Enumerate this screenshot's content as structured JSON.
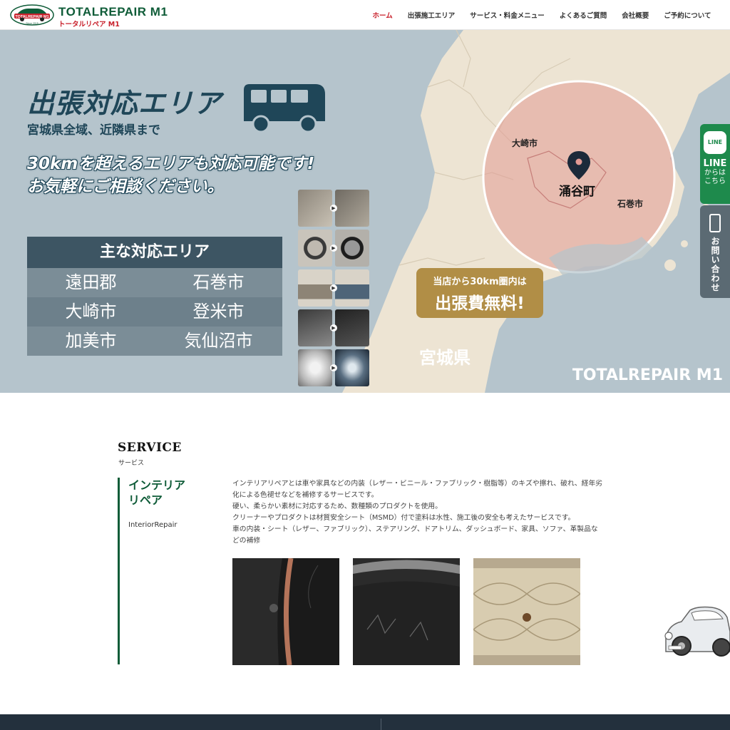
{
  "header": {
    "logo_badge_text": "TOTALREPAIR M1",
    "logo_since": "Since 2015",
    "logo_title": "TOTALREPAIR M1",
    "logo_sub": "トータルリペア M1",
    "nav": [
      {
        "label": "ホーム",
        "active": true
      },
      {
        "label": "出張施工エリア",
        "active": false
      },
      {
        "label": "サービス・料金メニュー",
        "active": false
      },
      {
        "label": "よくあるご質問",
        "active": false
      },
      {
        "label": "会社概要",
        "active": false
      },
      {
        "label": "ご予約について",
        "active": false
      }
    ]
  },
  "hero": {
    "title": "出張対応エリア",
    "subtitle": "宮城県全域、近隣県まで",
    "message_line1": "30kmを超えるエリアも対応可能です!",
    "message_line2": "お気軽にご相談ください。",
    "areas_heading": "主な対応エリア",
    "areas": [
      [
        "遠田郡",
        "石巻市"
      ],
      [
        "大崎市",
        "登米市"
      ],
      [
        "加美市",
        "気仙沼市"
      ]
    ],
    "free_small": "当店から30km圏内は",
    "free_big": "出張費無料!",
    "map_labels": {
      "osaki": "大崎市",
      "center": "涌谷町",
      "ishinomaki": "石巻市",
      "prefecture": "宮城県"
    },
    "brand": "TOTALREPAIR M1"
  },
  "side_tabs": {
    "line_icon": "LINE",
    "line_label": "LINE",
    "line_sub1": "からは",
    "line_sub2": "こちら",
    "tel_label": "お問い合わせ"
  },
  "service": {
    "heading": "SERVICE",
    "heading_sub": "サービス",
    "name_line1": "インテリア",
    "name_line2": "リペア",
    "name_en": "InteriorRepair",
    "description": [
      "インテリアリペアとは車や家具などの内装（レザー・ビニール・ファブリック・樹脂等）のキズや擦れ、破れ、経年劣",
      "化による色褪せなどを補修するサービスです。",
      "硬い、柔らかい素材に対応するため、数種類のプロダクトを使用。",
      "クリーナーやプロダクトは材質安全シート（MSMD）付で塗料は水性、施工後の安全も考えたサービスです。",
      "車の内装・シート（レザー、ファブリック）、ステアリング、ドアトリム、ダッシュボード、家具、ソファ、革製品な",
      "どの補修"
    ]
  },
  "colors": {
    "brand_green": "#0f5c38",
    "accent_red": "#c8202b",
    "hero_bg": "#b5c4cc",
    "gold": "#b18e46",
    "navy": "#1f4658"
  }
}
